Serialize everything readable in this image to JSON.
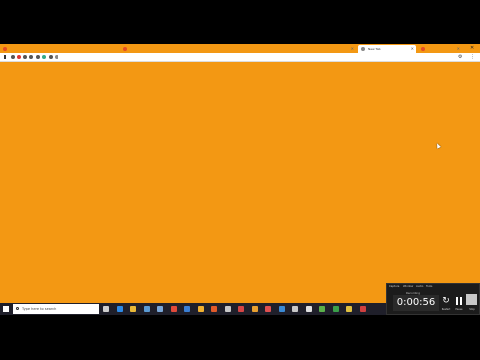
{
  "browser": {
    "tabs": [
      {
        "label": "",
        "state": "inactive",
        "favicon_color": "#e34c26"
      },
      {
        "label": "",
        "state": "inactive",
        "favicon_color": "#e34c26"
      },
      {
        "label": "New Tab",
        "state": "active",
        "favicon_color": "#888888"
      },
      {
        "label": "",
        "state": "inactive",
        "favicon_color": "#e34c26"
      }
    ],
    "window_controls": {
      "minimize": "–",
      "maximize": "□",
      "close": "✕"
    },
    "url_host": "",
    "url_path": "",
    "more_icon": "⋮"
  },
  "desktop": {
    "background_color": "#f39813"
  },
  "taskbar": {
    "search_placeholder": "Type here to search",
    "apps": [
      {
        "name": "task-view-icon",
        "color": "#cfcfcf"
      },
      {
        "name": "edge-icon",
        "color": "#2d8ae6"
      },
      {
        "name": "file-explorer-icon",
        "color": "#e8b838"
      },
      {
        "name": "store-icon",
        "color": "#5a9bd4"
      },
      {
        "name": "mail-icon",
        "color": "#7aa7d8"
      },
      {
        "name": "chrome-icon",
        "color": "#e04a3a"
      },
      {
        "name": "app-icon-7",
        "color": "#3a7fd4"
      },
      {
        "name": "app-icon-8",
        "color": "#f0b030"
      },
      {
        "name": "app-icon-9",
        "color": "#e05a2a"
      },
      {
        "name": "app-icon-10",
        "color": "#c8c8c8"
      },
      {
        "name": "app-icon-11",
        "color": "#d64545"
      },
      {
        "name": "app-icon-12",
        "color": "#e8a030"
      },
      {
        "name": "app-icon-13",
        "color": "#e05050"
      },
      {
        "name": "app-icon-14",
        "color": "#3a8ad4"
      },
      {
        "name": "app-icon-15",
        "color": "#c8c8c8"
      },
      {
        "name": "app-icon-16",
        "color": "#e0e0e0"
      },
      {
        "name": "app-icon-17",
        "color": "#5ab04a"
      },
      {
        "name": "app-icon-18",
        "color": "#3aa04a"
      },
      {
        "name": "app-icon-19",
        "color": "#e0c040"
      },
      {
        "name": "app-icon-20",
        "color": "#d04040"
      }
    ]
  },
  "recorder": {
    "menu": [
      "Capture",
      "Window",
      "Audio",
      "Tools"
    ],
    "status": "Recording",
    "timer": "0:00:56",
    "restart_label": "Restart",
    "pause_label": "Pause",
    "stop_label": "Stop"
  }
}
